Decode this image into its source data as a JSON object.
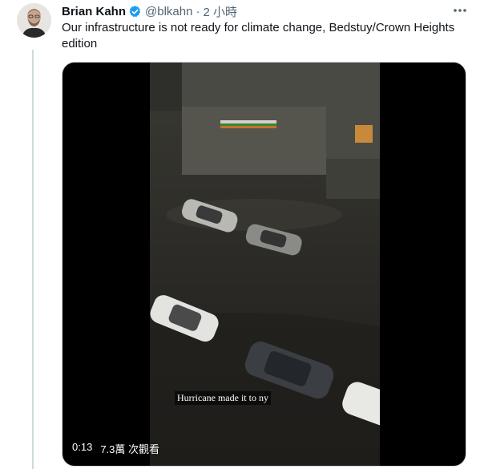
{
  "tweet": {
    "author_name": "Brian Kahn",
    "handle": "@blkahn",
    "separator": "·",
    "time": "2 小時",
    "text": "Our infrastructure is not ready for climate change, Bedstuy/Crown Heights edition",
    "verified_icon": "verified-badge-icon",
    "more_icon": "more-options-icon"
  },
  "video": {
    "caption": "Hurricane made it to ny",
    "duration": "0:13",
    "views": "7.3萬 次觀看"
  },
  "colors": {
    "verified": "#1d9bf0",
    "secondary_text": "#536471",
    "thread_line": "#cfd9de"
  }
}
